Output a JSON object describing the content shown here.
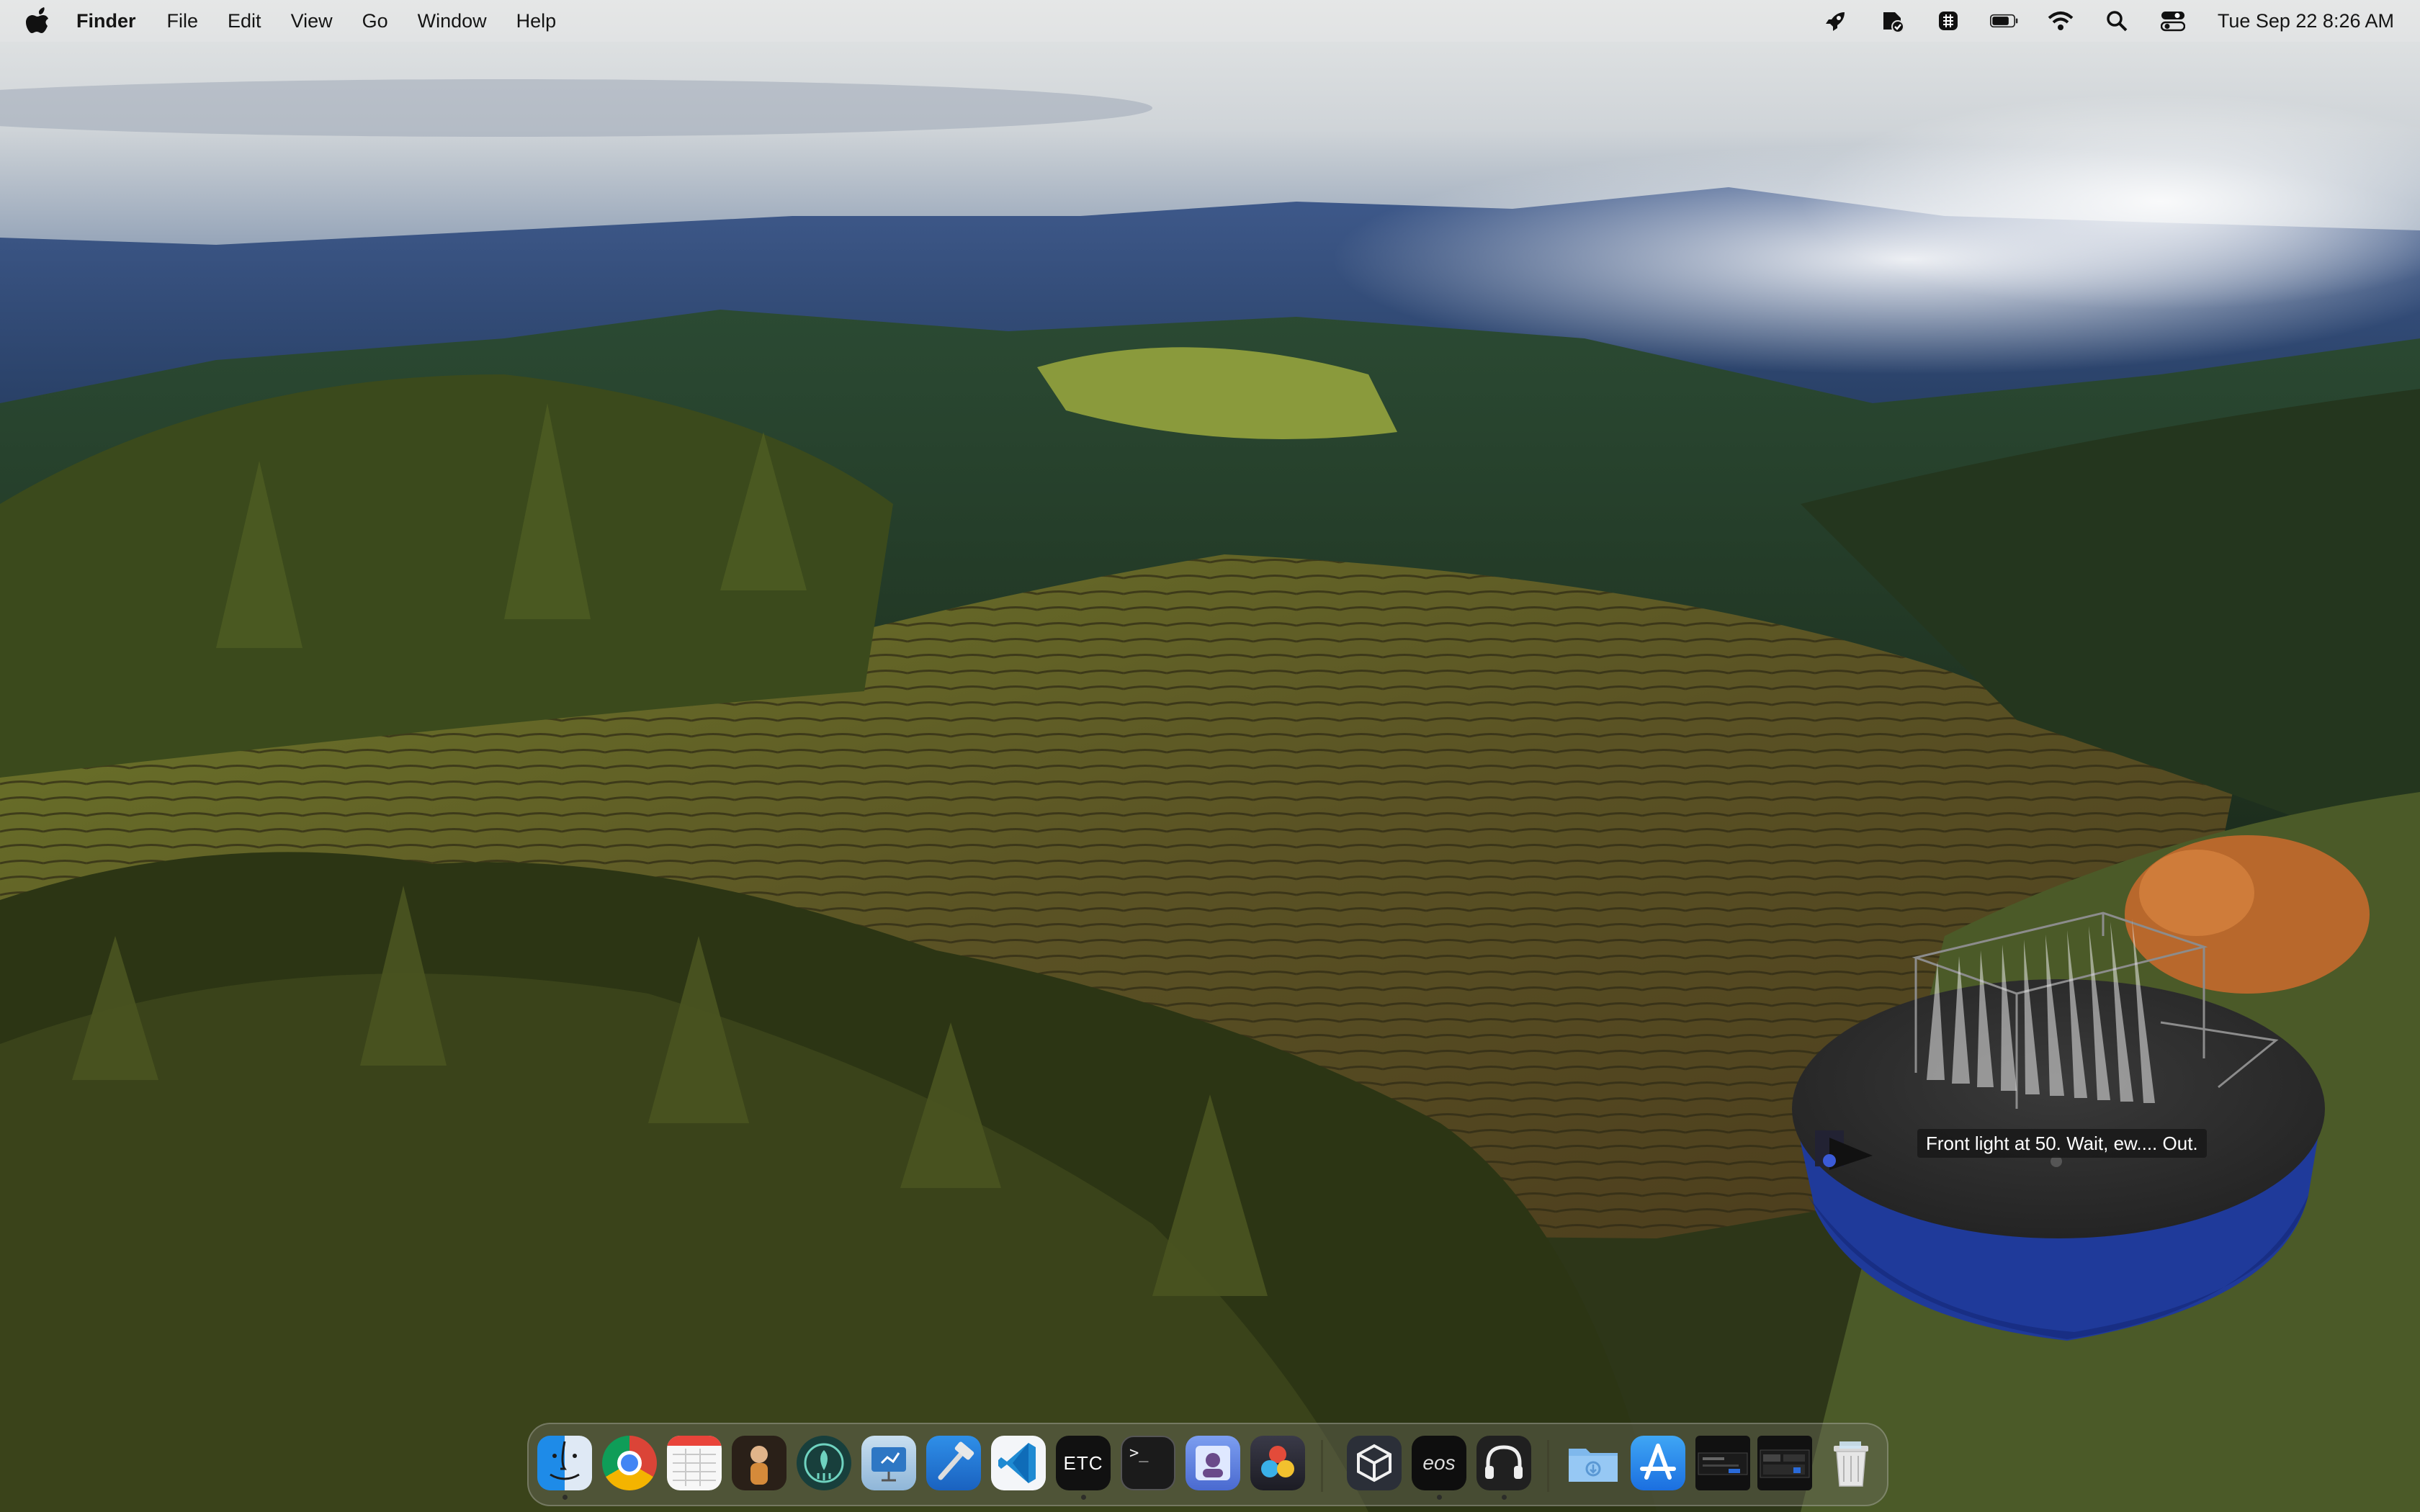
{
  "menubar": {
    "app_name": "Finder",
    "menus": [
      "File",
      "Edit",
      "View",
      "Go",
      "Window",
      "Help"
    ],
    "clock": "Tue Sep 22  8:26 AM",
    "status_icons": [
      "rocket-icon",
      "check-badge-icon",
      "grid-badge-icon",
      "battery-icon",
      "wifi-icon",
      "search-icon",
      "control-center-icon"
    ]
  },
  "stage": {
    "tooltip": "Front light at 50. Wait, ew.... Out."
  },
  "dock": {
    "apps": [
      {
        "name": "Finder",
        "icon": "finder-icon",
        "running": true
      },
      {
        "name": "Google Chrome",
        "icon": "chrome-icon",
        "running": false
      },
      {
        "name": "Calendar Grid",
        "icon": "spreadsheet-icon",
        "running": false
      },
      {
        "name": "Avatar App",
        "icon": "avatar-app-icon",
        "running": false
      },
      {
        "name": "GitKraken",
        "icon": "gitkraken-icon",
        "running": false
      },
      {
        "name": "Keynote Helper",
        "icon": "presentation-icon",
        "running": false
      },
      {
        "name": "Xcode",
        "icon": "hammer-icon",
        "running": false
      },
      {
        "name": "Visual Studio Code",
        "icon": "vscode-icon",
        "running": false
      },
      {
        "name": "ETC",
        "icon": "etc-icon",
        "running": true
      },
      {
        "name": "Terminal",
        "icon": "terminal-icon",
        "running": false
      },
      {
        "name": "Preview",
        "icon": "preview-icon",
        "running": false
      },
      {
        "name": "DaVinci Resolve",
        "icon": "davinci-icon",
        "running": false
      },
      {
        "name": "Unity",
        "icon": "unity-icon",
        "running": false
      },
      {
        "name": "Eos",
        "icon": "eos-icon",
        "running": true
      },
      {
        "name": "Headset App",
        "icon": "headphones-icon",
        "running": true
      },
      {
        "name": "Downloads",
        "icon": "downloads-folder-icon",
        "running": false
      },
      {
        "name": "App Store",
        "icon": "app-store-icon",
        "running": false
      },
      {
        "name": "Window Preview 1",
        "icon": "window-thumbnail-icon",
        "running": false
      },
      {
        "name": "Window Preview 2",
        "icon": "window-thumbnail-icon",
        "running": false
      },
      {
        "name": "Trash",
        "icon": "trash-icon",
        "running": false
      }
    ],
    "labels": {
      "etc": "ETC",
      "eos": "eos",
      "terminal": ">_"
    }
  }
}
